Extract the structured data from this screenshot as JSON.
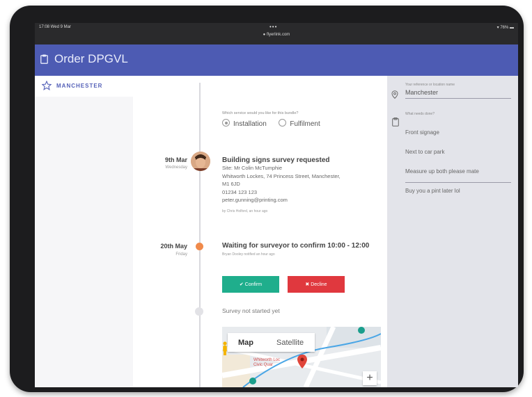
{
  "status_bar": {
    "time": "17:08  Wed 9 Mar",
    "url": "● flyerlink.com",
    "battery": "▾ 76% ▬"
  },
  "header": {
    "title": "Order DPGVL"
  },
  "nav": {
    "tab_label": "MANCHESTER"
  },
  "service": {
    "question": "Which service would you like for this bundle?",
    "options": [
      "Installation",
      "Fulfilment"
    ],
    "selected": "Installation"
  },
  "timeline": {
    "entry1": {
      "date": "9th Mar",
      "weekday": "Wednesday",
      "title": "Building signs survey requested",
      "lines": [
        "Site: Mr Colin McTumphie",
        "Whitworth Lockes, 74 Princess Street, Manchester,",
        "M1 6JD",
        "01234 123 123",
        "peter.gunning@printing.com"
      ],
      "by": "by Chris Holford, an hour ago"
    },
    "entry2": {
      "date": "20th May",
      "weekday": "Friday",
      "title": "Waiting for surveyor to confirm 10:00 - 12:00",
      "by": "Bryan Dooley notified an hour ago",
      "confirm_label": "✔ Confirm",
      "decline_label": "✖ Decline"
    },
    "entry3": {
      "text": "Survey not started yet"
    }
  },
  "map": {
    "tab_map": "Map",
    "tab_satellite": "Satellite",
    "place_label": "Whitworth Loc\nCivic Quar",
    "zoom_in": "+"
  },
  "side_panel": {
    "ref_label": "Your reference or location name",
    "ref_value": "Manchester",
    "notes_label": "What needs done?",
    "notes": [
      "Front signage",
      "Next to car park",
      "Measure up both please mate",
      "Buy you a pint later lol"
    ]
  },
  "colors": {
    "accent": "#4d5bb3",
    "confirm": "#1fae8c",
    "decline": "#e0383e",
    "pending": "#f08a4b"
  }
}
